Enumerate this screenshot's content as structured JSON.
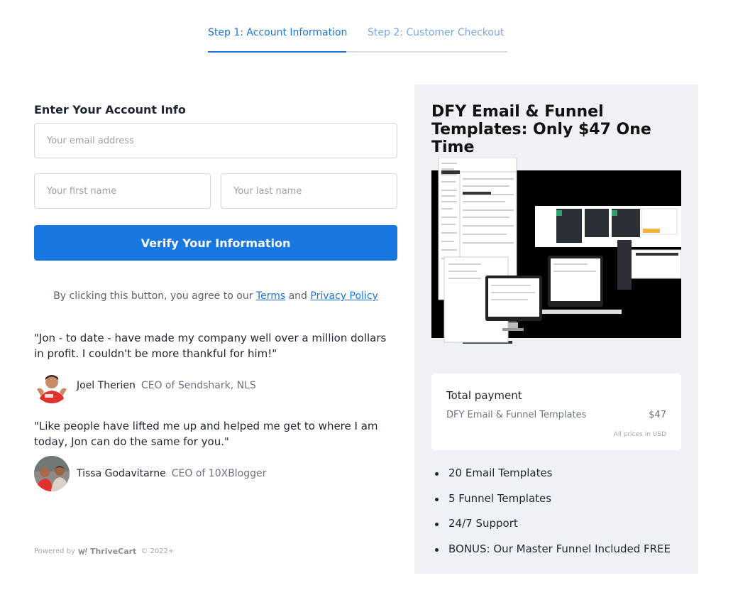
{
  "steps": {
    "step1": "Step 1: Account Information",
    "step2": "Step 2: Customer Checkout"
  },
  "form": {
    "title": "Enter Your Account Info",
    "email_placeholder": "Your email address",
    "first_placeholder": "Your first name",
    "last_placeholder": "Your last name",
    "verify_label": "Verify Your Information",
    "agree_prefix": "By clicking this button, you agree to our",
    "terms": "Terms",
    "and": "and",
    "privacy": "Privacy Policy"
  },
  "testimonials": [
    {
      "quote": "\"Jon - to date - have made my company well over a million dollars in profit. I couldn't be more thankful for him!\"",
      "name": "Joel Therien",
      "role": "CEO of Sendshark, NLS"
    },
    {
      "quote": "\"Like people have lifted me up and helped me get to where I am today, Jon can do the same for you.\"",
      "name": "Tissa Godavitarne",
      "role": "CEO of 10XBlogger"
    }
  ],
  "footer": {
    "powered_by": "Powered by",
    "brand": "ThriveCart",
    "year": "© 2022+"
  },
  "product": {
    "title": "DFY Email & Funnel Templates: Only $47 One Time"
  },
  "summary": {
    "title": "Total payment",
    "item": "DFY Email & Funnel Templates",
    "price": "$47",
    "note": "All prices in USD"
  },
  "features": [
    "20 Email Templates",
    "5 Funnel Templates",
    "24/7 Support",
    "BONUS: Our Master Funnel Included FREE"
  ],
  "colors": {
    "accent": "#1877e0",
    "panel_bg": "#eef2f6"
  }
}
